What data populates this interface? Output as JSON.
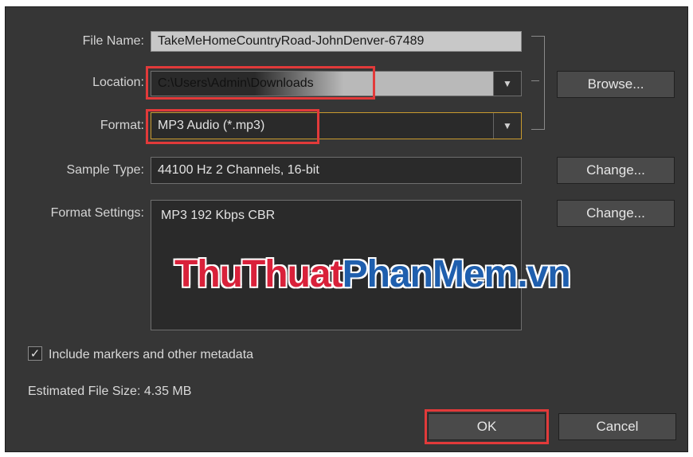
{
  "dialog": {
    "file_name_label": "File Name:",
    "file_name_value": "TakeMeHomeCountryRoad-JohnDenver-67489",
    "location_label": "Location:",
    "location_value": "C:\\Users\\Admin\\Downloads",
    "format_label": "Format:",
    "format_value": "MP3 Audio (*.mp3)",
    "sample_type_label": "Sample Type:",
    "sample_type_value": "44100 Hz 2 Channels, 16-bit",
    "format_settings_label": "Format Settings:",
    "format_settings_value": "MP3 192 Kbps CBR",
    "browse_label": "Browse...",
    "change_label": "Change...",
    "include_metadata_label": "Include markers and other metadata",
    "include_metadata_checked": true,
    "estimated_size_label": "Estimated File Size: 4.35 MB",
    "ok_label": "OK",
    "cancel_label": "Cancel"
  },
  "watermark": {
    "part1": "ThuThuat",
    "part2": "PhanMem.vn"
  },
  "colors": {
    "dialog_bg": "#363636",
    "highlight": "#e23a3a",
    "watermark_red": "#d9213a",
    "watermark_blue": "#1f5fae"
  }
}
